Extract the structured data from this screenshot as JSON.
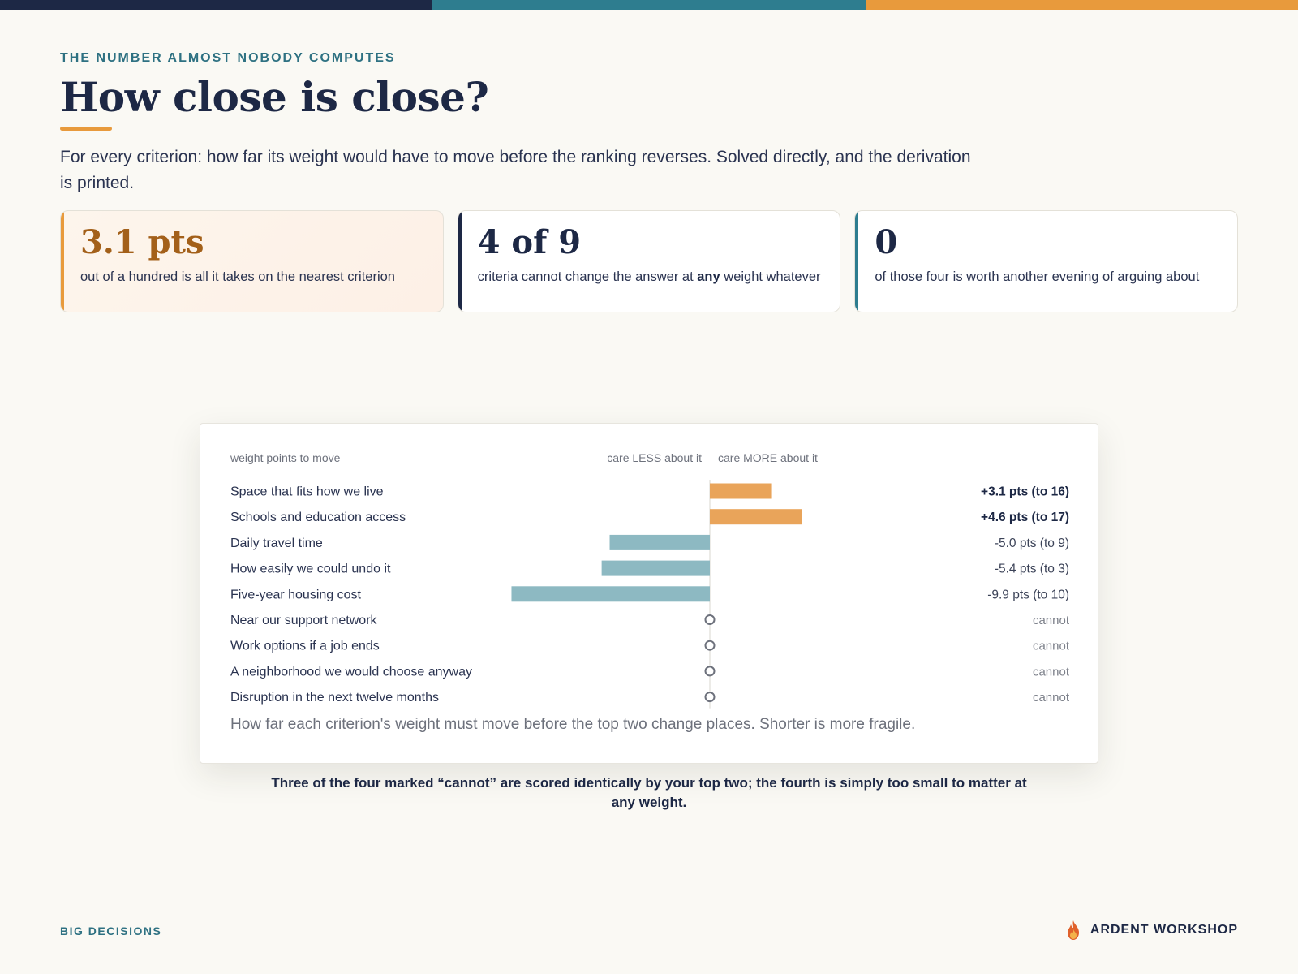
{
  "header": {
    "eyebrow": "THE NUMBER ALMOST NOBODY COMPUTES",
    "title": "How close is close?",
    "subtitle": "For every criterion: how far its weight would have to move before the ranking reverses. Solved directly, and the derivation is printed."
  },
  "cards": [
    {
      "big": "3.1 pts",
      "text_before": "out of a hundred is all it takes on the nearest criterion",
      "bold": "",
      "text_after": ""
    },
    {
      "big": "4 of 9",
      "text_before": "criteria cannot change the answer at ",
      "bold": "any",
      "text_after": " weight whatever"
    },
    {
      "big": "0",
      "text_before": "of those four is worth another evening of arguing about",
      "bold": "",
      "text_after": ""
    }
  ],
  "chart_data": {
    "type": "bar",
    "orientation": "horizontal-diverging",
    "column_header_left": "weight points to move",
    "column_header_less": "care LESS about it",
    "column_header_more": "care MORE about it",
    "rows": [
      {
        "label": "Space that fits how we live",
        "value": 3.1,
        "value_label": "+3.1 pts (to 16)",
        "reversible": true,
        "emphasis": true
      },
      {
        "label": "Schools and education access",
        "value": 4.6,
        "value_label": "+4.6 pts (to 17)",
        "reversible": true,
        "emphasis": true
      },
      {
        "label": "Daily travel time",
        "value": -5.0,
        "value_label": "-5.0 pts (to 9)",
        "reversible": true,
        "emphasis": false
      },
      {
        "label": "How easily we could undo it",
        "value": -5.4,
        "value_label": "-5.4 pts (to 3)",
        "reversible": true,
        "emphasis": false
      },
      {
        "label": "Five-year housing cost",
        "value": -9.9,
        "value_label": "-9.9 pts (to 10)",
        "reversible": true,
        "emphasis": false
      },
      {
        "label": "Near our support network",
        "value": null,
        "value_label": "cannot",
        "reversible": false,
        "emphasis": false
      },
      {
        "label": "Work options if a job ends",
        "value": null,
        "value_label": "cannot",
        "reversible": false,
        "emphasis": false
      },
      {
        "label": "A neighborhood we would choose anyway",
        "value": null,
        "value_label": "cannot",
        "reversible": false,
        "emphasis": false
      },
      {
        "label": "Disruption in the next twelve months",
        "value": null,
        "value_label": "cannot",
        "reversible": false,
        "emphasis": false
      }
    ],
    "colors": {
      "more": "#e9a45a",
      "less": "#8db9c2",
      "marker": "#6d717c"
    },
    "caption": "How far each criterion's weight must move before the top two change places. Shorter is more fragile."
  },
  "footnote": "Three of the four marked “cannot” are scored identically by your top two; the fourth is simply too small to matter at any weight.",
  "footer": {
    "left": "BIG DECISIONS",
    "brand": "ARDENT WORKSHOP",
    "brand_icon": "flame-icon"
  }
}
